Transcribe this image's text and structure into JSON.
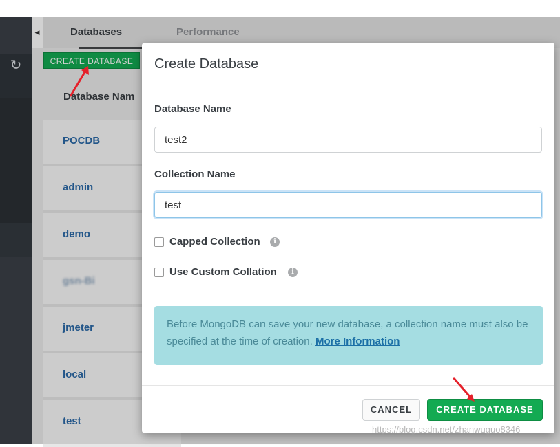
{
  "sidebar": {
    "refresh_icon": "refresh-icon"
  },
  "tabs": [
    {
      "label": "Databases",
      "active": true
    },
    {
      "label": "Performance",
      "active": false
    }
  ],
  "toolbar": {
    "create_database_label": "CREATE DATABASE"
  },
  "table": {
    "column_header": "Database Nam",
    "rows": [
      "POCDB",
      "admin",
      "demo",
      "gsn-Bi",
      "jmeter",
      "local",
      "test"
    ]
  },
  "modal": {
    "title": "Create Database",
    "database_name_label": "Database Name",
    "database_name_value": "test2",
    "collection_name_label": "Collection Name",
    "collection_name_value": "test",
    "capped_collection_label": "Capped Collection",
    "custom_collation_label": "Use Custom Collation",
    "info_text": "Before MongoDB can save your new database, a collection name must also be specified at the time of creation.",
    "info_link": "More Information",
    "cancel_label": "CANCEL",
    "create_label": "CREATE DATABASE"
  },
  "watermark": "https://blog.csdn.net/zhanwuguo8346",
  "colors": {
    "accent_green": "#13aa52",
    "info_bg": "#a5dde2",
    "sidebar_bg": "#3b4047",
    "annotation_arrow": "#e5202a"
  }
}
